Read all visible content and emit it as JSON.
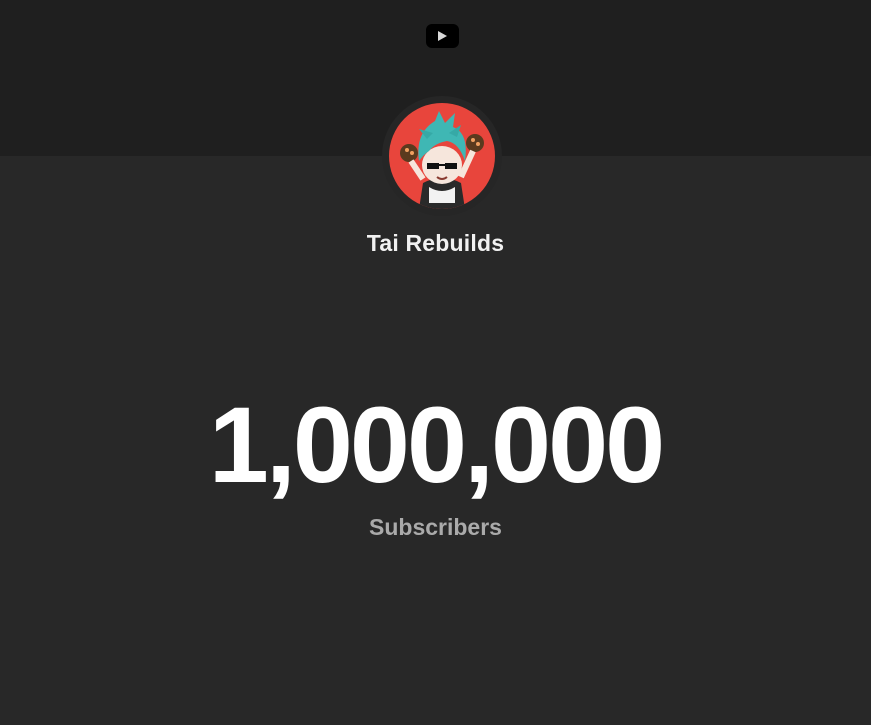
{
  "header": {
    "logo_icon": "youtube-play-icon",
    "band_color": "#1f1f1f"
  },
  "channel": {
    "avatar_icon": "cartoon-avatar",
    "avatar_bg": "#e8453c",
    "name": "Tai Rebuilds"
  },
  "stats": {
    "count": "1,000,000",
    "label": "Subscribers"
  }
}
